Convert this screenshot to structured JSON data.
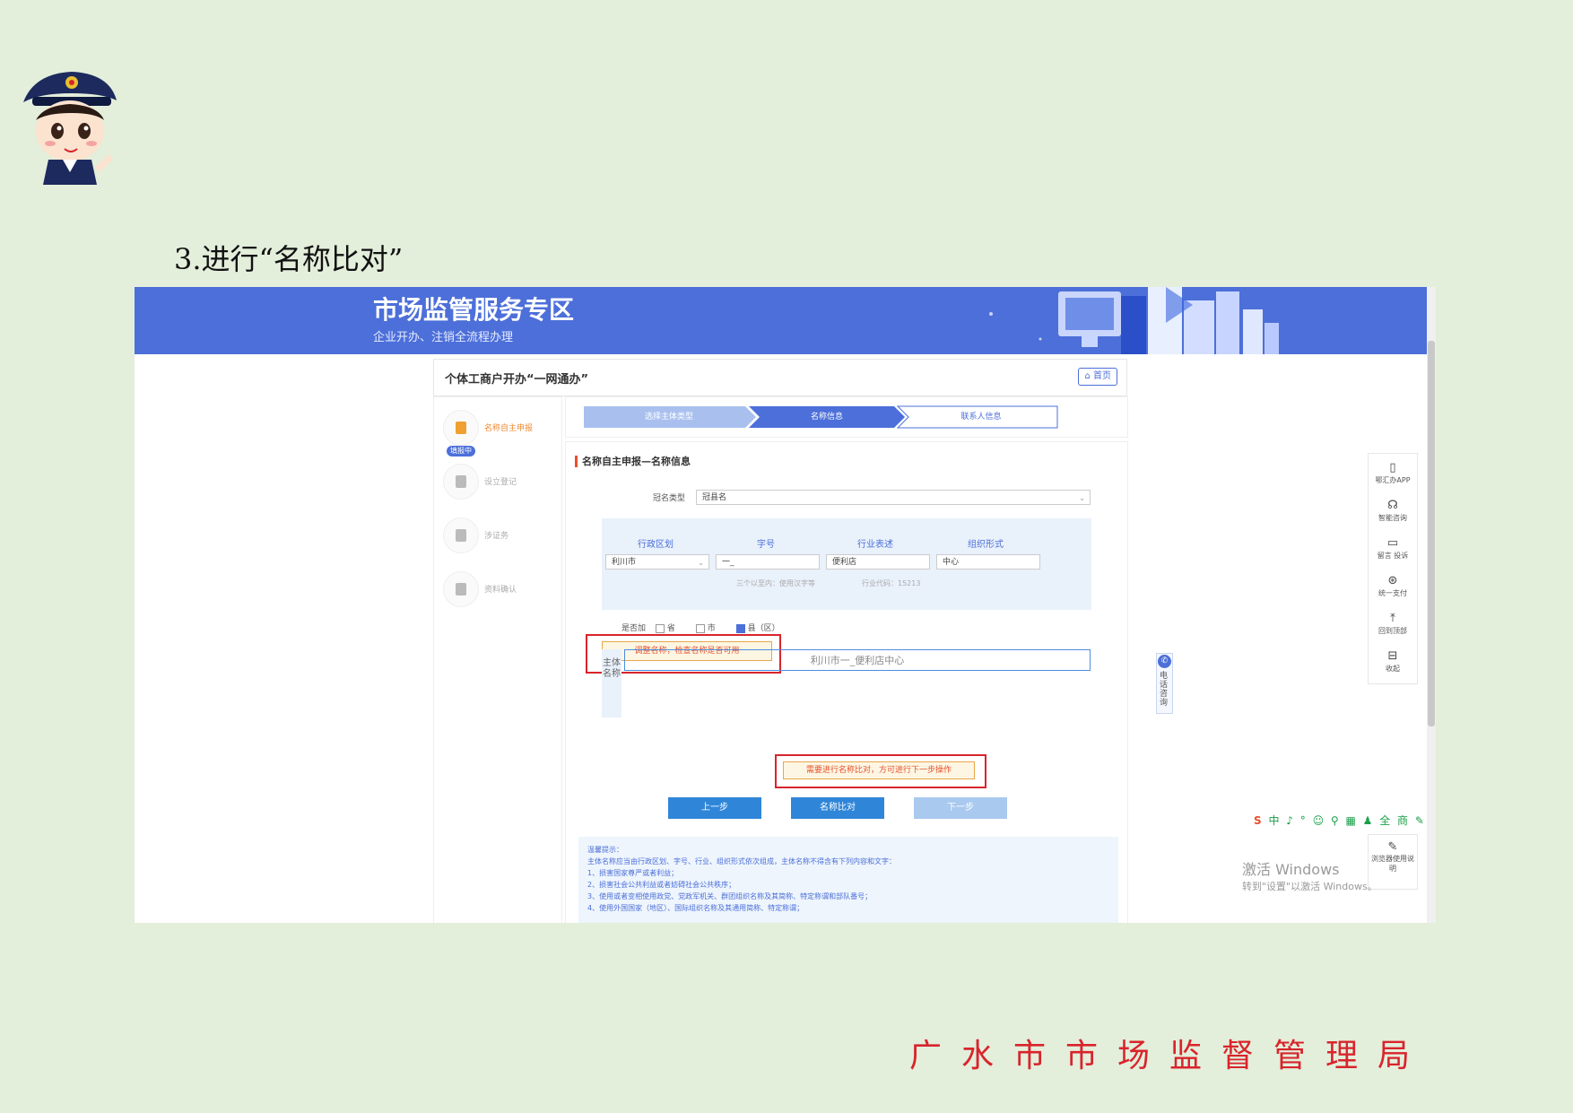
{
  "slide": {
    "title": "3.进行“名称比对”",
    "footer_org": "广水市市场监督管理局"
  },
  "banner": {
    "title": "市场监管服务专区",
    "subtitle": "企业开办、注销全流程办理"
  },
  "panel": {
    "title": "个体工商户开办“一网通办”",
    "home_label": "首页"
  },
  "sidenav": {
    "items": [
      {
        "label": "名称自主申报",
        "badge": "填报中"
      },
      {
        "label": "设立登记"
      },
      {
        "label": "涉证务"
      },
      {
        "label": "资料确认"
      }
    ]
  },
  "steps": [
    "选择主体类型",
    "名称信息",
    "联系人信息"
  ],
  "form": {
    "section_title": "名称自主申报—名称信息",
    "name_type_label": "冠名类型",
    "name_type_value": "冠县名",
    "columns": [
      "行政区划",
      "字号",
      "行业表述",
      "组织形式"
    ],
    "values": {
      "district": "利川市",
      "trade_name": "一_",
      "industry": "便利店",
      "org_form": "中心"
    },
    "hints": [
      "三个以至内：使用汉字等",
      "行业代码：15213"
    ],
    "include_label": "是否加",
    "checkboxes": [
      {
        "label": "省",
        "checked": false
      },
      {
        "label": "市",
        "checked": false
      },
      {
        "label": "县（区）",
        "checked": true
      }
    ],
    "warn_top": "调整名称，检查名称是否可用",
    "subject_label": "主体名称",
    "subject_name": "利川市一_便利店中心",
    "warn_bottom": "需要进行名称比对，方可进行下一步操作",
    "buttons": {
      "prev": "上一步",
      "compare": "名称比对",
      "next": "下一步"
    },
    "notice_title": "温馨提示：",
    "notice_lines": [
      "主体名称应当由行政区划、字号、行业、组织形式依次组成，主体名称不得含有下列内容和文字：",
      "1、损害国家尊严或者利益；",
      "2、损害社会公共利益或者妨碍社会公共秩序；",
      "3、使用或者变相使用政党、党政军机关、群团组织名称及其简称、特定称谓和部队番号；",
      "4、使用外国国家（地区）、国际组织名称及其通用简称、特定称谓；"
    ]
  },
  "tools": [
    {
      "icon": "phone-icon",
      "label": "鄂汇办APP"
    },
    {
      "icon": "headset-icon",
      "label": "智能咨询"
    },
    {
      "icon": "message-icon",
      "label": "留言 投诉"
    },
    {
      "icon": "pay-icon",
      "label": "统一支付"
    },
    {
      "icon": "back-to-top-icon",
      "label": "回到顶部"
    },
    {
      "icon": "collapse-icon",
      "label": "收起"
    }
  ],
  "tool_bottom": {
    "label": "浏览器使用说明"
  },
  "phone_tab": {
    "label": "电话咨询"
  },
  "ime_bar": "中 ♪ ° ☺ ⚲ ▦ ♟ 全 商 ✎",
  "watermark": {
    "line1": "激活 Windows",
    "line2": "转到\"设置\"以激活 Windows。"
  },
  "colors": {
    "banner_blue": "#4c6fd9",
    "button_blue": "#2f86d9",
    "highlight_red": "#d9242b",
    "background_green": "#e3eedb"
  }
}
